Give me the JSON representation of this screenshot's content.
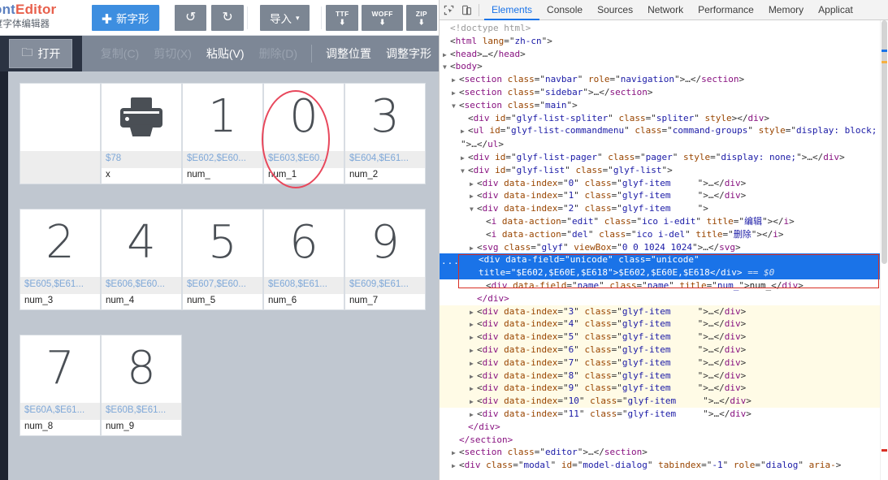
{
  "app": {
    "logo": {
      "part1": "ont",
      "part2": "Editor",
      "subtitle": "度字体编辑器"
    },
    "toolbar": {
      "new_glyph": {
        "label": "新字形",
        "icon": "plus-icon"
      },
      "undo": {
        "label": "撤销",
        "icon": "undo-icon",
        "glyph": "↺"
      },
      "redo": {
        "label": "重做",
        "icon": "redo-icon",
        "glyph": "↻"
      },
      "import": {
        "label": "导入",
        "caret": "▾"
      },
      "export_ttf": {
        "label": "TTF",
        "arrow": "⬇"
      },
      "export_woff": {
        "label": "WOFF",
        "arrow": "⬇"
      },
      "export_zip": {
        "label": "ZIP",
        "arrow": "⬇"
      }
    },
    "commandbar": {
      "open": {
        "label": "打开",
        "icon": "folder-open-icon"
      },
      "copy": "复制(C)",
      "cut": "剪切(X)",
      "paste": "粘贴(V)",
      "delete": "删除(D)",
      "adjust_position": "调整位置",
      "adjust_glyph": "调整字形"
    },
    "glyphs": [
      {
        "char": "",
        "unicode": "",
        "name": "",
        "kind": "blank"
      },
      {
        "char": "",
        "unicode": "$78",
        "name": "x",
        "kind": "printer"
      },
      {
        "char": "1",
        "unicode": "$E602,$E60...",
        "name": "num_",
        "kind": "text",
        "annotated": true
      },
      {
        "char": "0",
        "unicode": "$E603,$E60...",
        "name": "num_1",
        "kind": "text"
      },
      {
        "char": "3",
        "unicode": "$E604,$E61...",
        "name": "num_2",
        "kind": "text"
      },
      {
        "char": "2",
        "unicode": "$E605,$E61...",
        "name": "num_3",
        "kind": "text"
      },
      {
        "char": "4",
        "unicode": "$E606,$E60...",
        "name": "num_4",
        "kind": "text"
      },
      {
        "char": "5",
        "unicode": "$E607,$E60...",
        "name": "num_5",
        "kind": "text"
      },
      {
        "char": "6",
        "unicode": "$E608,$E61...",
        "name": "num_6",
        "kind": "text"
      },
      {
        "char": "9",
        "unicode": "$E609,$E61...",
        "name": "num_7",
        "kind": "text"
      },
      {
        "char": "7",
        "unicode": "$E60A,$E61...",
        "name": "num_8",
        "kind": "text"
      },
      {
        "char": "8",
        "unicode": "$E60B,$E61...",
        "name": "num_9",
        "kind": "text"
      }
    ]
  },
  "devtools": {
    "icons": {
      "inspect": "inspect-element-icon",
      "device": "device-toolbar-icon"
    },
    "tabs": [
      {
        "label": "Elements",
        "active": true
      },
      {
        "label": "Console",
        "active": false
      },
      {
        "label": "Sources",
        "active": false
      },
      {
        "label": "Network",
        "active": false
      },
      {
        "label": "Performance",
        "active": false
      },
      {
        "label": "Memory",
        "active": false
      },
      {
        "label": "Applicat",
        "active": false
      }
    ],
    "tree": [
      {
        "indent": 0,
        "arrow": "none",
        "raw_doctype": "<!doctype html>"
      },
      {
        "indent": 0,
        "arrow": "none",
        "tag": "html",
        "attrs": [
          [
            "lang",
            "zh-cn"
          ]
        ],
        "close": ""
      },
      {
        "indent": 0,
        "arrow": "closed",
        "tag": "head",
        "attrs": [],
        "ellipsis": true,
        "closetag": "head"
      },
      {
        "indent": 0,
        "arrow": "open",
        "tag": "body",
        "attrs": [],
        "close": ""
      },
      {
        "indent": 1,
        "arrow": "closed",
        "tag": "section",
        "attrs": [
          [
            "class",
            "navbar"
          ],
          [
            "role",
            "navigation"
          ]
        ],
        "ellipsis": true,
        "closetag": "section"
      },
      {
        "indent": 1,
        "arrow": "closed",
        "tag": "section",
        "attrs": [
          [
            "class",
            "sidebar"
          ]
        ],
        "ellipsis": true,
        "closetag": "section"
      },
      {
        "indent": 1,
        "arrow": "open",
        "tag": "section",
        "attrs": [
          [
            "class",
            "main"
          ]
        ],
        "close": ""
      },
      {
        "indent": 2,
        "arrow": "none",
        "tag": "div",
        "attrs": [
          [
            "id",
            "glyf-list-spliter"
          ],
          [
            "class",
            "spliter"
          ],
          [
            "style",
            null
          ]
        ],
        "closetag": "div"
      },
      {
        "indent": 2,
        "arrow": "closed",
        "tag": "ul",
        "attrs": [
          [
            "id",
            "glyf-list-commandmenu"
          ],
          [
            "class",
            "command-groups"
          ],
          [
            "style",
            "display: block;\n"
          ]
        ],
        "ellipsis": true,
        "closetag": "ul",
        "wrap": true
      },
      {
        "indent": 2,
        "arrow": "closed",
        "tag": "div",
        "attrs": [
          [
            "id",
            "glyf-list-pager"
          ],
          [
            "class",
            "pager"
          ],
          [
            "style",
            "display: none;"
          ]
        ],
        "ellipsis": true,
        "closetag": "div"
      },
      {
        "indent": 2,
        "arrow": "open",
        "tag": "div",
        "attrs": [
          [
            "id",
            "glyf-list"
          ],
          [
            "class",
            "glyf-list"
          ]
        ],
        "close": ""
      },
      {
        "indent": 3,
        "arrow": "closed",
        "tag": "div",
        "attrs": [
          [
            "data-index",
            "0"
          ],
          [
            "class",
            "glyf-item     "
          ]
        ],
        "ellipsis": true,
        "closetag": "div"
      },
      {
        "indent": 3,
        "arrow": "closed",
        "tag": "div",
        "attrs": [
          [
            "data-index",
            "1"
          ],
          [
            "class",
            "glyf-item     "
          ]
        ],
        "ellipsis": true,
        "closetag": "div"
      },
      {
        "indent": 3,
        "arrow": "open",
        "tag": "div",
        "attrs": [
          [
            "data-index",
            "2"
          ],
          [
            "class",
            "glyf-item     "
          ]
        ],
        "close": ""
      },
      {
        "indent": 4,
        "arrow": "none",
        "tag": "i",
        "attrs": [
          [
            "data-action",
            "edit"
          ],
          [
            "class",
            "ico i-edit"
          ],
          [
            "title",
            "编辑"
          ]
        ],
        "closetag": "i"
      },
      {
        "indent": 4,
        "arrow": "none",
        "tag": "i",
        "attrs": [
          [
            "data-action",
            "del"
          ],
          [
            "class",
            "ico i-del"
          ],
          [
            "title",
            "删除"
          ]
        ],
        "closetag": "i"
      },
      {
        "indent": 3,
        "arrow": "closed",
        "tag": "svg",
        "attrs": [
          [
            "class",
            "glyf"
          ],
          [
            "viewBox",
            "0 0 1024 1024"
          ]
        ],
        "ellipsis": true,
        "closetag": "svg"
      }
    ],
    "selected_node": {
      "tag": "div",
      "attr_field": "data-field",
      "attr_field_val": "unicode",
      "attr_class": "class",
      "attr_class_val": "unicode",
      "attr_title": "title",
      "attr_title_val": "$E602,$E60E,$E618",
      "text": "$E602,$E60E,$E618",
      "close": "</div>",
      "marker": "== $0",
      "ellipsis_badge": "..."
    },
    "after_selected": [
      {
        "indent": 4,
        "arrow": "none",
        "tag": "div",
        "attrs": [
          [
            "data-field",
            "name"
          ],
          [
            "class",
            "name"
          ],
          [
            "title",
            "num_"
          ]
        ],
        "text": "num_",
        "closetag": "div"
      },
      {
        "indent": 3,
        "arrow": "none",
        "closeonly": "</div>"
      },
      {
        "indent": 3,
        "arrow": "closed",
        "tag": "div",
        "attrs": [
          [
            "data-index",
            "3"
          ],
          [
            "class",
            "glyf-item     "
          ]
        ],
        "ellipsis": true,
        "closetag": "div",
        "hl": true
      },
      {
        "indent": 3,
        "arrow": "closed",
        "tag": "div",
        "attrs": [
          [
            "data-index",
            "4"
          ],
          [
            "class",
            "glyf-item     "
          ]
        ],
        "ellipsis": true,
        "closetag": "div",
        "hl": true
      },
      {
        "indent": 3,
        "arrow": "closed",
        "tag": "div",
        "attrs": [
          [
            "data-index",
            "5"
          ],
          [
            "class",
            "glyf-item     "
          ]
        ],
        "ellipsis": true,
        "closetag": "div",
        "hl": true
      },
      {
        "indent": 3,
        "arrow": "closed",
        "tag": "div",
        "attrs": [
          [
            "data-index",
            "6"
          ],
          [
            "class",
            "glyf-item     "
          ]
        ],
        "ellipsis": true,
        "closetag": "div",
        "hl": true
      },
      {
        "indent": 3,
        "arrow": "closed",
        "tag": "div",
        "attrs": [
          [
            "data-index",
            "7"
          ],
          [
            "class",
            "glyf-item     "
          ]
        ],
        "ellipsis": true,
        "closetag": "div",
        "hl": true
      },
      {
        "indent": 3,
        "arrow": "closed",
        "tag": "div",
        "attrs": [
          [
            "data-index",
            "8"
          ],
          [
            "class",
            "glyf-item     "
          ]
        ],
        "ellipsis": true,
        "closetag": "div",
        "hl": true
      },
      {
        "indent": 3,
        "arrow": "closed",
        "tag": "div",
        "attrs": [
          [
            "data-index",
            "9"
          ],
          [
            "class",
            "glyf-item     "
          ]
        ],
        "ellipsis": true,
        "closetag": "div",
        "hl": true
      },
      {
        "indent": 3,
        "arrow": "closed",
        "tag": "div",
        "attrs": [
          [
            "data-index",
            "10"
          ],
          [
            "class",
            "glyf-item     "
          ]
        ],
        "ellipsis": true,
        "closetag": "div",
        "hl": true
      },
      {
        "indent": 3,
        "arrow": "closed",
        "tag": "div",
        "attrs": [
          [
            "data-index",
            "11"
          ],
          [
            "class",
            "glyf-item     "
          ]
        ],
        "ellipsis": true,
        "closetag": "div"
      },
      {
        "indent": 2,
        "arrow": "none",
        "closeonly": "</div>"
      },
      {
        "indent": 1,
        "arrow": "none",
        "closeonly": "</section>"
      },
      {
        "indent": 1,
        "arrow": "closed",
        "tag": "section",
        "attrs": [
          [
            "class",
            "editor"
          ]
        ],
        "ellipsis": true,
        "closetag": "section"
      },
      {
        "indent": 1,
        "arrow": "closed",
        "tag": "div",
        "attrs": [
          [
            "class",
            "modal"
          ],
          [
            "id",
            "model-dialog"
          ],
          [
            "tabindex",
            "-1"
          ],
          [
            "role",
            "dialog"
          ],
          [
            "aria-",
            null
          ]
        ],
        "wrap": true,
        "trailing": ""
      }
    ]
  },
  "colors": {
    "accent_blue": "#1a73e8",
    "primary_button": "#3d8ee0",
    "annotation_red": "#d93025",
    "ellipse_red": "#e8485c",
    "app_bg": "#c0c7d0",
    "toolbar_grey": "#7c8693"
  }
}
